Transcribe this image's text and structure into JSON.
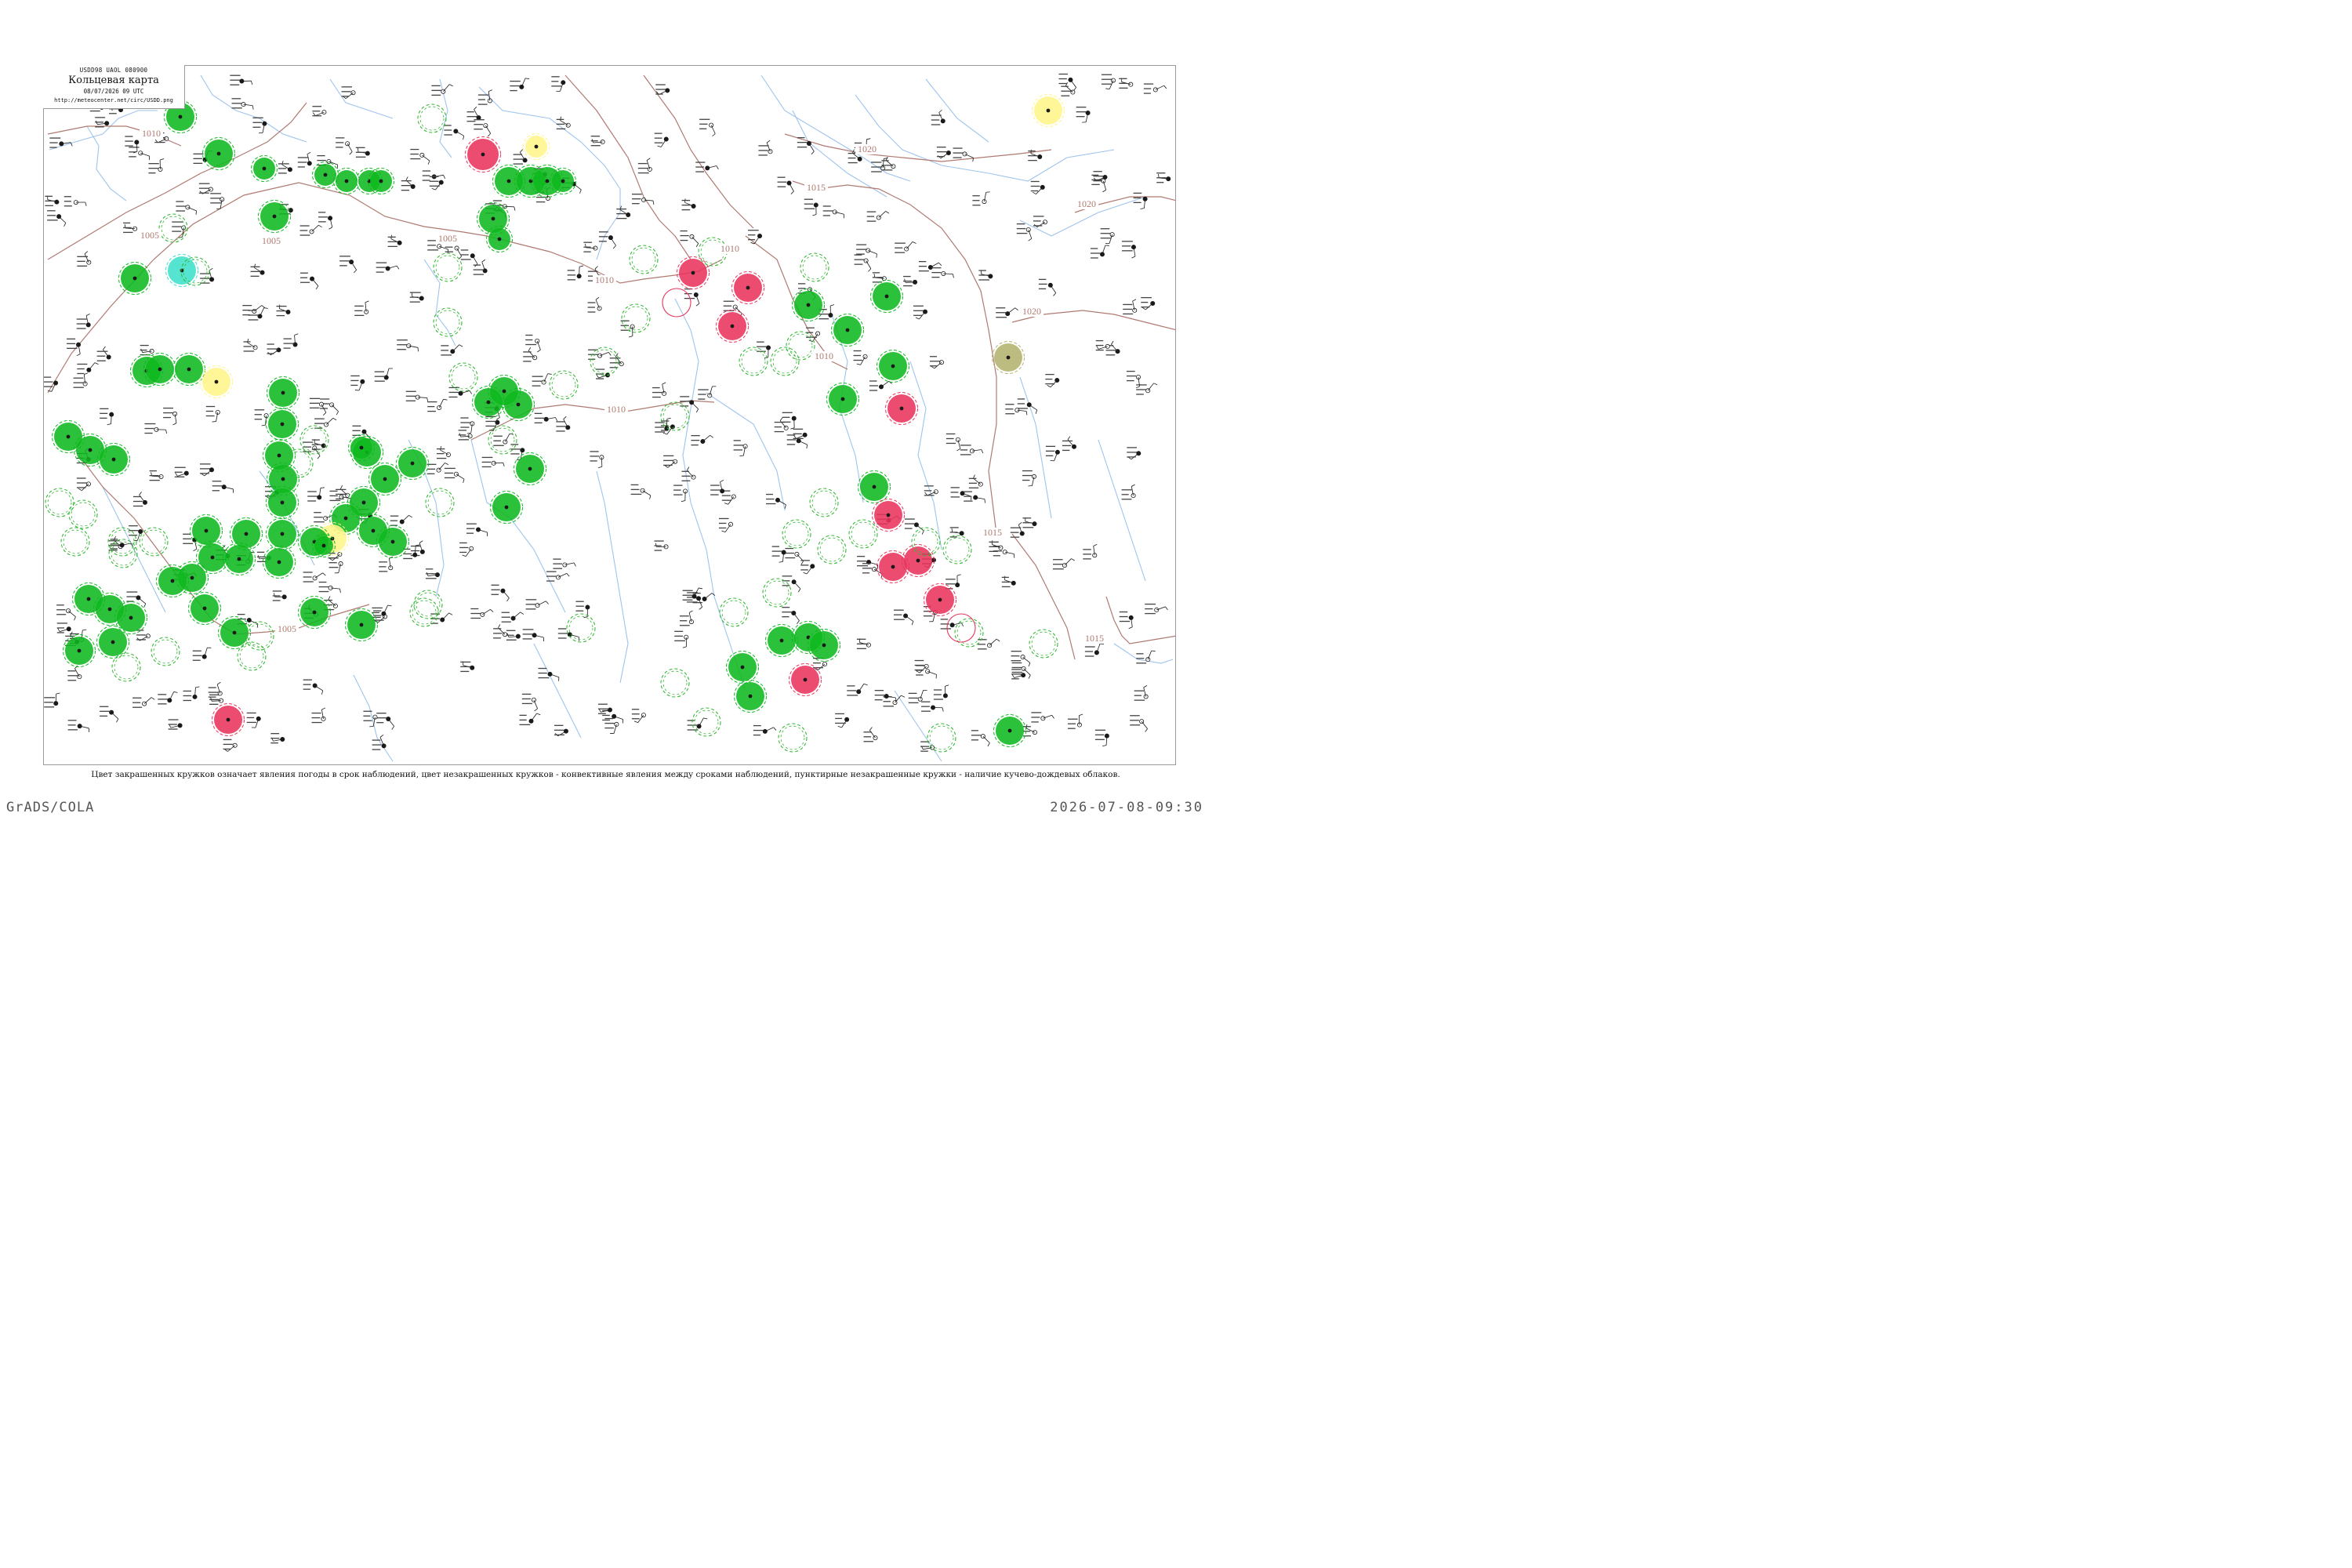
{
  "header": {
    "bulletin_code": "USDD98  UAOL  080900",
    "title": "Кольцевая карта",
    "datetime": "08/07/2026 09 UTC",
    "url": "http://meteocenter.net/circ/USDD.png"
  },
  "isobars": [
    "1000",
    "1005",
    "1010",
    "1015",
    "1020"
  ],
  "legend": {
    "caption": "Цвет закрашенных кружков означает явления погоды в срок наблюдений, цвет незакрашенных кружков - конвективные явления между сроками наблюдений, пунктирные незакрашенные кружки - наличие кучево-дождевых облаков."
  },
  "footer": {
    "software": "GrADS/COLA",
    "timestamp": "2026-07-08-09:30"
  },
  "colors": {
    "isobar": "#b07a72",
    "river": "#9ec4ee",
    "thunderstorm_fill": "#0fb81f",
    "hail_fill": "#e8335c",
    "fog_fill": "#fff58a",
    "shower_fill": "#3ce0c8",
    "dust_fill": "#b3b370",
    "cb_dashed": "#35b935",
    "station_ink": "#1a1a1a"
  }
}
